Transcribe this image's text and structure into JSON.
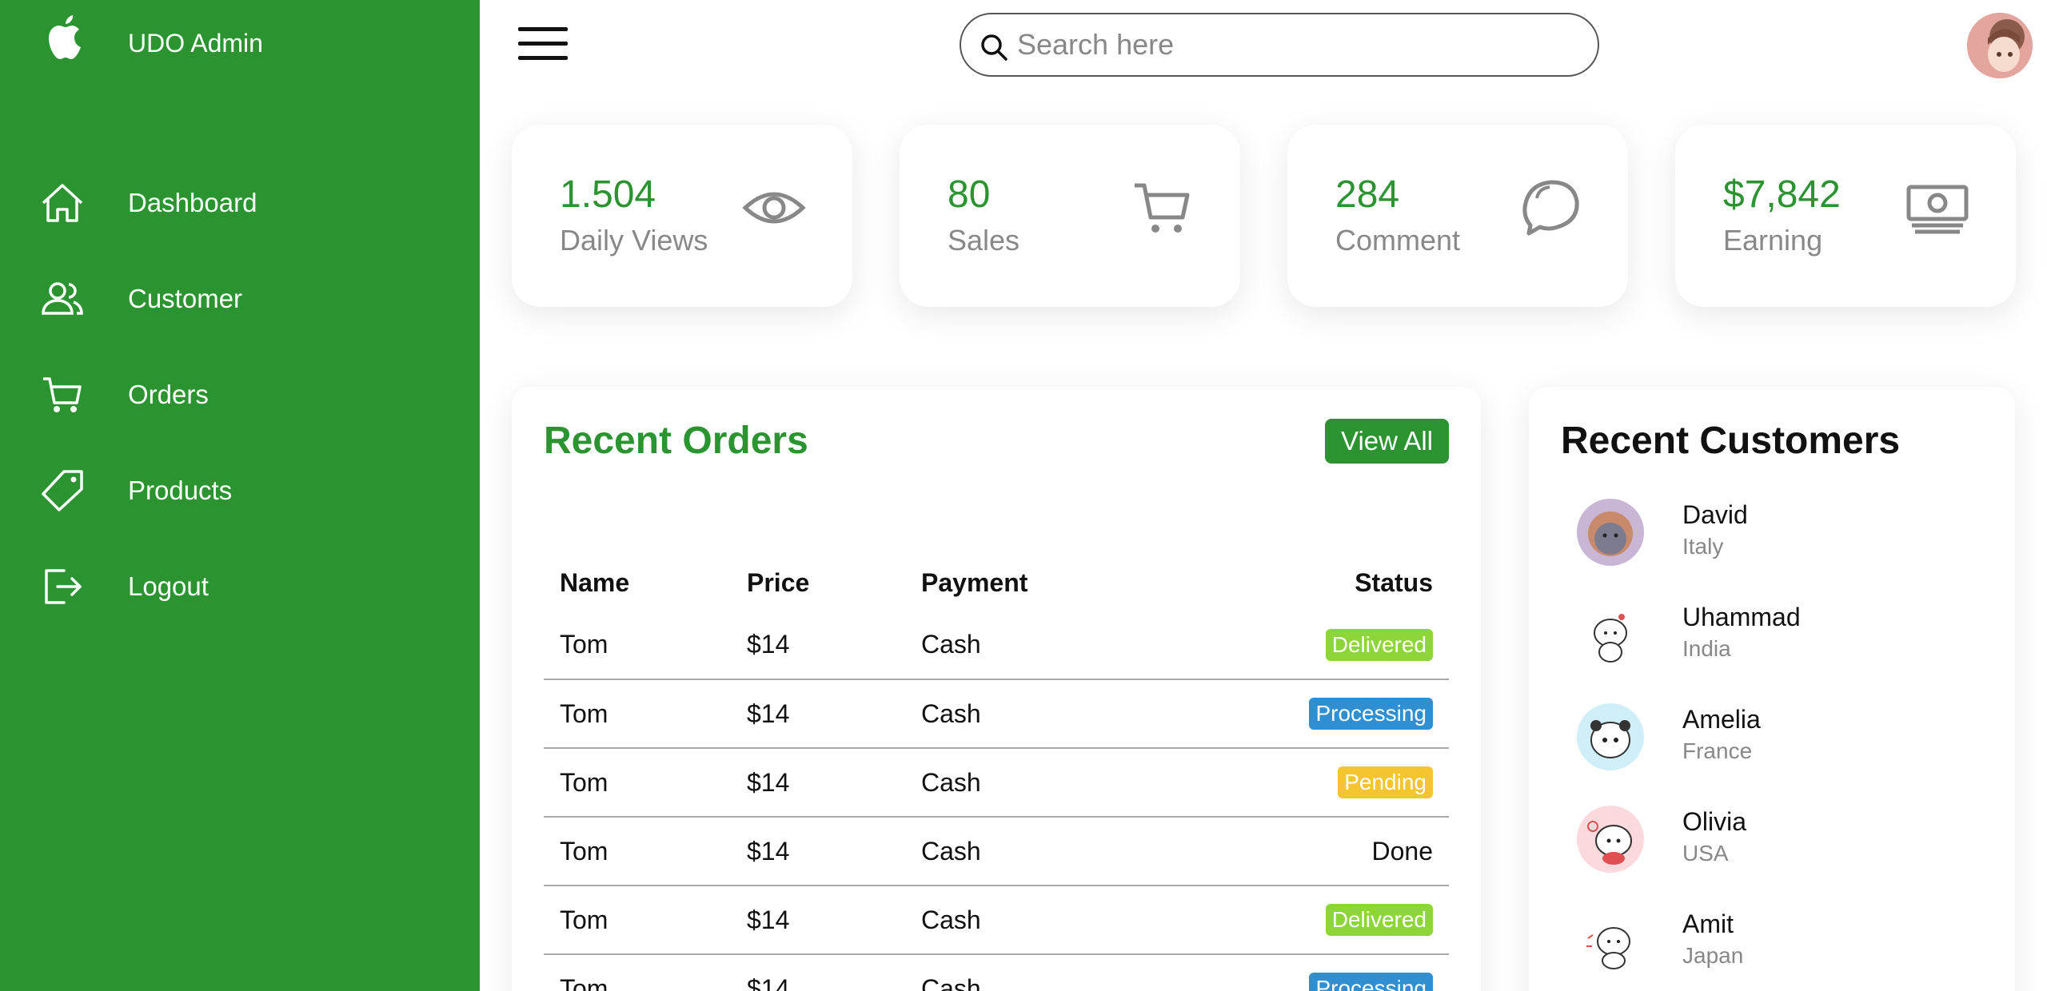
{
  "brand": {
    "name": "UDO Admin",
    "logo_icon": "apple-icon"
  },
  "sidebar": {
    "items": [
      {
        "label": "Dashboard",
        "icon": "home-icon"
      },
      {
        "label": "Customer",
        "icon": "users-icon"
      },
      {
        "label": "Orders",
        "icon": "cart-icon"
      },
      {
        "label": "Products",
        "icon": "tag-icon"
      },
      {
        "label": "Logout",
        "icon": "logout-icon"
      }
    ]
  },
  "search": {
    "placeholder": "Search here",
    "value": ""
  },
  "cards": [
    {
      "number": "1.504",
      "label": "Daily Views",
      "icon": "eye-icon"
    },
    {
      "number": "80",
      "label": "Sales",
      "icon": "cart-icon"
    },
    {
      "number": "284",
      "label": "Comment",
      "icon": "comment-icon"
    },
    {
      "number": "$7,842",
      "label": "Earning",
      "icon": "cash-icon"
    }
  ],
  "orders": {
    "title": "Recent Orders",
    "view_all_label": "View All",
    "headers": [
      "Name",
      "Price",
      "Payment",
      "Status"
    ],
    "rows": [
      {
        "name": "Tom",
        "price": "$14",
        "payment": "Cash",
        "status": "Delivered",
        "status_type": "delivered"
      },
      {
        "name": "Tom",
        "price": "$14",
        "payment": "Cash",
        "status": "Processing",
        "status_type": "processing"
      },
      {
        "name": "Tom",
        "price": "$14",
        "payment": "Cash",
        "status": "Pending",
        "status_type": "pending"
      },
      {
        "name": "Tom",
        "price": "$14",
        "payment": "Cash",
        "status": "Done",
        "status_type": "done"
      },
      {
        "name": "Tom",
        "price": "$14",
        "payment": "Cash",
        "status": "Delivered",
        "status_type": "delivered"
      },
      {
        "name": "Tom",
        "price": "$14",
        "payment": "Cash",
        "status": "Processing",
        "status_type": "processing"
      }
    ]
  },
  "customers": {
    "title": "Recent Customers",
    "items": [
      {
        "name": "David",
        "country": "Italy"
      },
      {
        "name": "Uhammad",
        "country": "India"
      },
      {
        "name": "Amelia",
        "country": "France"
      },
      {
        "name": "Olivia",
        "country": "USA"
      },
      {
        "name": "Amit",
        "country": "Japan"
      }
    ]
  },
  "colors": {
    "brand": "#2b9430",
    "delivered": "#8cd63a",
    "processing": "#2f8fd1",
    "pending": "#f5c431",
    "muted": "#888888"
  }
}
